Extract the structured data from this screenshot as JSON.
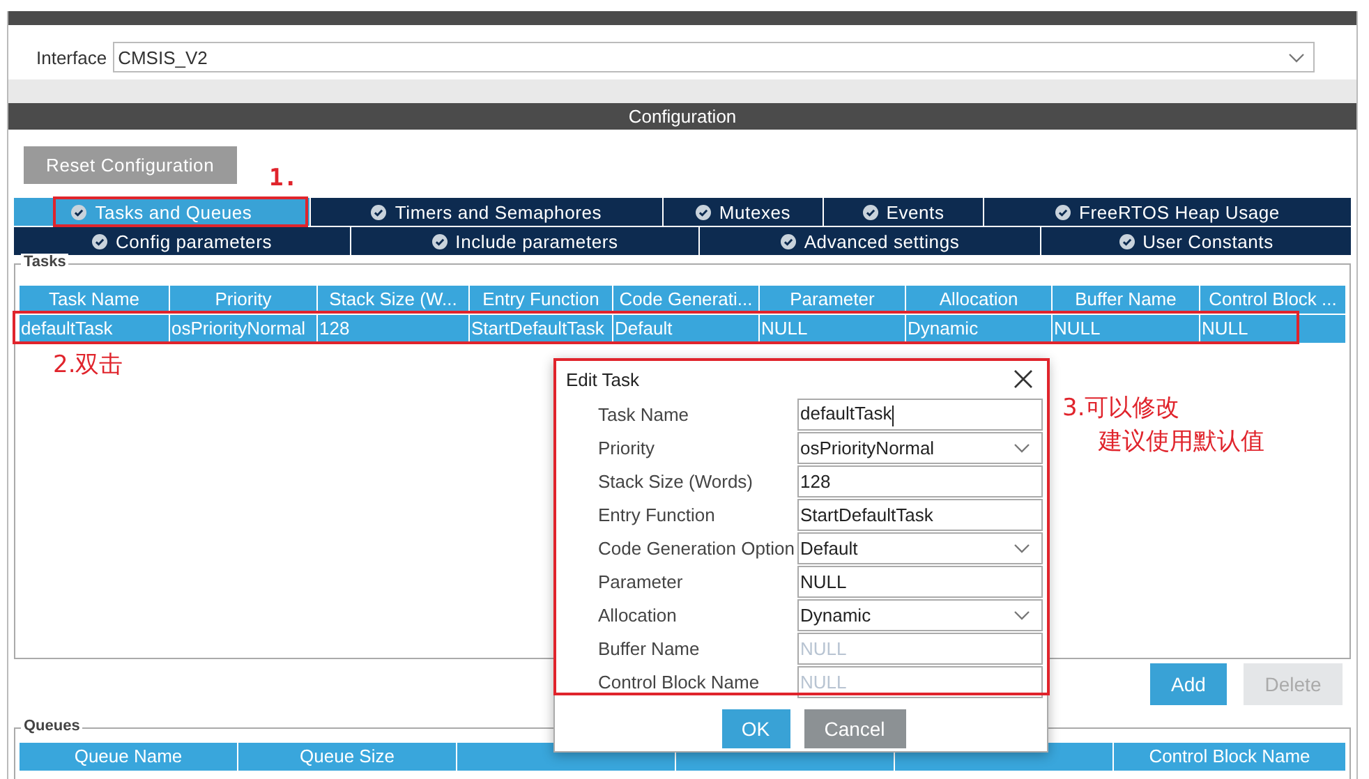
{
  "interface": {
    "label": "Interface",
    "value": "CMSIS_V2"
  },
  "configuration": {
    "title": "Configuration",
    "reset_button": "Reset Configuration",
    "tab_rows": [
      [
        {
          "label": "Tasks and Queues",
          "selected": true
        },
        {
          "label": "Timers and Semaphores",
          "selected": false
        },
        {
          "label": "Mutexes",
          "selected": false
        },
        {
          "label": "Events",
          "selected": false
        },
        {
          "label": "FreeRTOS Heap Usage",
          "selected": false
        }
      ],
      [
        {
          "label": "Config parameters",
          "selected": false
        },
        {
          "label": "Include parameters",
          "selected": false
        },
        {
          "label": "Advanced settings",
          "selected": false
        },
        {
          "label": "User Constants",
          "selected": false
        }
      ]
    ]
  },
  "tasks": {
    "title": "Tasks",
    "columns": [
      "Task Name",
      "Priority",
      "Stack Size (W...",
      "Entry Function",
      "Code Generati...",
      "Parameter",
      "Allocation",
      "Buffer Name",
      "Control Block ..."
    ],
    "rows": [
      {
        "cells": [
          "defaultTask",
          "osPriorityNormal",
          "128",
          "StartDefaultTask",
          "Default",
          "NULL",
          "Dynamic",
          "NULL",
          "NULL"
        ],
        "selected": true
      }
    ],
    "add_button": {
      "label": "Add",
      "disabled": false
    },
    "delete_button": {
      "label": "Delete",
      "disabled": true
    }
  },
  "queues": {
    "title": "Queues",
    "columns": [
      {
        "label": "Queue Name"
      },
      {
        "label": "Queue Size"
      },
      {},
      {},
      {},
      {
        "label": "Control Block Name"
      }
    ]
  },
  "dialog": {
    "title": "Edit Task",
    "fields": [
      {
        "label": "Task Name",
        "value": "defaultTask",
        "kind": "text",
        "disabled": false
      },
      {
        "label": "Priority",
        "value": "osPriorityNormal",
        "kind": "select",
        "disabled": false
      },
      {
        "label": "Stack Size (Words)",
        "value": "128",
        "kind": "text",
        "disabled": false
      },
      {
        "label": "Entry Function",
        "value": "StartDefaultTask",
        "kind": "text",
        "disabled": false
      },
      {
        "label": "Code Generation Option",
        "value": "Default",
        "kind": "select",
        "disabled": false
      },
      {
        "label": "Parameter",
        "value": "NULL",
        "kind": "text",
        "disabled": false
      },
      {
        "label": "Allocation",
        "value": "Dynamic",
        "kind": "select",
        "disabled": false
      },
      {
        "label": "Buffer Name",
        "value": "NULL",
        "kind": "text",
        "disabled": true
      },
      {
        "label": "Control Block Name",
        "value": "NULL",
        "kind": "text",
        "disabled": true
      }
    ],
    "ok_button": "OK",
    "cancel_button": "Cancel"
  },
  "annotations": [
    {
      "lines": [
        "1."
      ]
    },
    {
      "lines": [
        "2.双击"
      ]
    },
    {
      "lines": [
        "3.可以修改",
        "建议使用默认值"
      ]
    }
  ]
}
